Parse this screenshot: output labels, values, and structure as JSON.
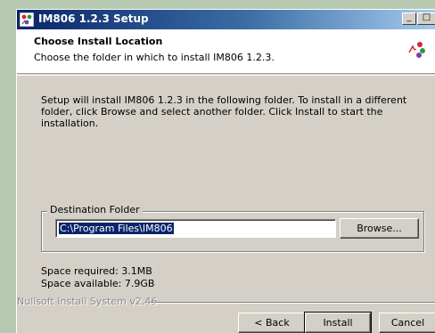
{
  "window": {
    "title": "IM806 1.2.3 Setup",
    "minimize_glyph": "_",
    "maximize_glyph": "□"
  },
  "header": {
    "title": "Choose Install Location",
    "subtitle": "Choose the folder in which to install IM806 1.2.3."
  },
  "body": {
    "description": "Setup will install IM806 1.2.3 in the following folder. To install in a different folder, click Browse and select another folder. Click Install to start the installation."
  },
  "destination": {
    "group_label": "Destination Folder",
    "path": "C:\\Program Files\\IM806",
    "browse_label": "Browse..."
  },
  "space": {
    "required": "Space required: 3.1MB",
    "available": "Space available: 7.9GB"
  },
  "footer": {
    "branding": "Nullsoft Install System v2.46",
    "back_label": "< Back",
    "install_label": "Install",
    "cancel_label": "Cancel"
  },
  "colors": {
    "title_bar_start": "#0a246a",
    "title_bar_end": "#a6caf0",
    "selection": "#0a246a",
    "dialog_face": "#d4d0c8",
    "desktop": "#b6c9b0"
  },
  "icons": {
    "app_icon": "installer-app-icon",
    "header_icon": "install-location-icon"
  }
}
